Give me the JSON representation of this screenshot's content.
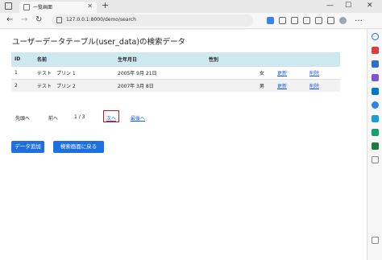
{
  "browser": {
    "tab_title": "一覧画面",
    "tab_close": "✕",
    "new_tab": "+",
    "url": "127.0.0.1:8000/demo/search",
    "controls": {
      "minimize": "—",
      "maximize": "☐",
      "close": "✕"
    },
    "nav": {
      "back": "←",
      "forward": "→",
      "reload": "↻"
    },
    "menu": "…"
  },
  "page": {
    "title": "ユーザーデータテーブル(user_data)の検索データ",
    "table": {
      "columns": [
        "ID",
        "名前",
        "生年月日",
        "性別",
        "",
        ""
      ],
      "rows": [
        {
          "id": "1",
          "name": "テスト　プリン 1",
          "birth": "2005年 9月 21日",
          "gender": "女",
          "update": "更新",
          "delete": "削除"
        },
        {
          "id": "2",
          "name": "テスト　プリン 2",
          "birth": "2007年 3月 8日",
          "gender": "男",
          "update": "更新",
          "delete": "削除"
        }
      ]
    },
    "pager": {
      "first": "先頭へ",
      "prev": "前へ",
      "page_info": "1 / 3",
      "next": "次へ",
      "last": "最後へ"
    },
    "buttons": {
      "add": "データ追加",
      "back": "検索画面に戻る"
    }
  },
  "colors": {
    "primary": "#1f6fe0",
    "table_header": "#cde8ef",
    "link": "#1a5fd6",
    "highlight": "#e01010"
  },
  "icons": [
    "browser-window-icon",
    "favicon-icon",
    "lock-icon",
    "star-icon",
    "extension-icon",
    "collections-icon",
    "profile-icon",
    "search-icon",
    "shopping-icon",
    "outlook-icon",
    "office-icon",
    "tools-icon",
    "games-icon",
    "add-icon",
    "settings-icon"
  ]
}
